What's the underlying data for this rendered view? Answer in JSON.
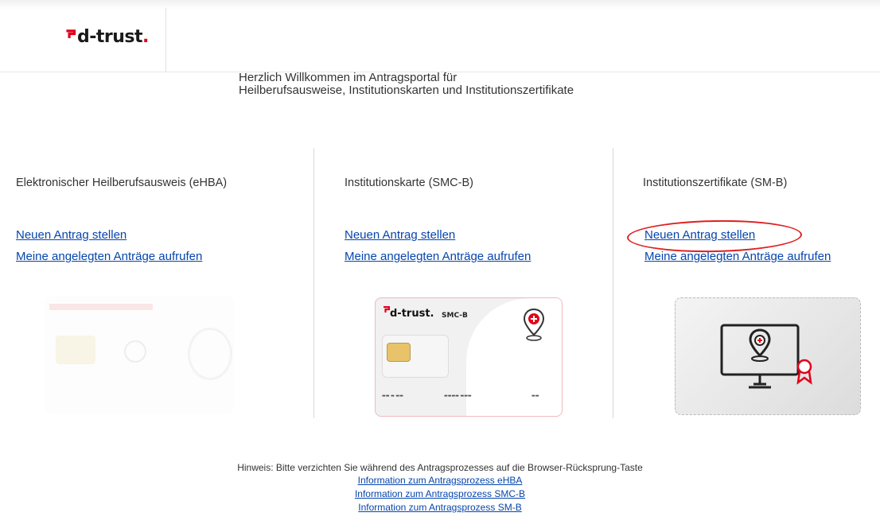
{
  "header": {
    "logo_text": "d-trust",
    "logo_dot": "."
  },
  "welcome": {
    "line1": "Herzlich Willkommen im Antragsportal für",
    "line2": "Heilberufsausweise, Institutionskarten und Institutionszertifikate"
  },
  "columns": [
    {
      "title": "Elektronischer Heilberufsausweis (eHBA)",
      "new_request": "Neuen Antrag stellen",
      "my_requests": "Meine angelegten Anträge aufrufen"
    },
    {
      "title": "Institutionskarte (SMC-B)",
      "new_request": "Neuen Antrag stellen",
      "my_requests": "Meine angelegten Anträge aufrufen"
    },
    {
      "title": "Institutionszertifikate (SM-B)",
      "new_request": "Neuen Antrag stellen",
      "my_requests": "Meine angelegten Anträge aufrufen"
    }
  ],
  "smcb_card": {
    "logo": "d-trust.",
    "label": "SMC-B"
  },
  "footer": {
    "hint": "Hinweis: Bitte verzichten Sie während des Antragsprozesses auf die Browser-Rücksprung-Taste",
    "links": [
      "Information zum Antragsprozess eHBA",
      "Information zum Antragsprozess SMC-B",
      "Information zum Antragsprozess SM-B"
    ]
  },
  "colors": {
    "brand_red": "#e2001a",
    "link_blue": "#0645ad",
    "highlight_circle": "#e02020"
  }
}
